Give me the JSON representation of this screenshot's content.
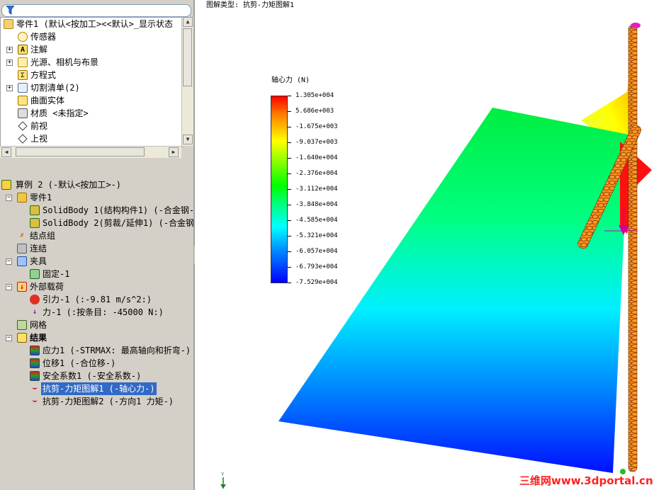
{
  "feature_tree": {
    "items": [
      {
        "label": "零件1  (默认<按加工><<默认>_显示状态",
        "icon": "part-icon"
      },
      {
        "label": "传感器",
        "icon": "sensor-icon"
      },
      {
        "label": "注解",
        "icon": "annotation-icon"
      },
      {
        "label": "光源、相机与布景",
        "icon": "lights-icon"
      },
      {
        "label": "方程式",
        "icon": "equations-icon"
      },
      {
        "label": "切割清单(2)",
        "icon": "cutlist-icon"
      },
      {
        "label": "曲面实体",
        "icon": "surface-body-icon"
      },
      {
        "label": "材质 <未指定>",
        "icon": "material-icon"
      },
      {
        "label": "前视",
        "icon": "plane-icon"
      },
      {
        "label": "上视",
        "icon": "plane-icon"
      }
    ]
  },
  "study_tree": {
    "items": [
      {
        "label": "算例 2 (-默认<按加工>-)"
      },
      {
        "label": "零件1"
      },
      {
        "label": "SolidBody 1(结构构件1) (-合金钢-"
      },
      {
        "label": "SolidBody 2(剪裁/延伸1) (-合金钢"
      },
      {
        "label": "结点组"
      },
      {
        "label": "连结"
      },
      {
        "label": "夹具"
      },
      {
        "label": "固定-1"
      },
      {
        "label": "外部载荷"
      },
      {
        "label": "引力-1 (:-9.81 m/s^2:)"
      },
      {
        "label": "力-1 (:按条目: -45000 N:)"
      },
      {
        "label": "网格"
      },
      {
        "label": "结果"
      },
      {
        "label": "应力1 (-STRMAX: 最高轴向和折弯-)"
      },
      {
        "label": "位移1 (-合位移-)"
      },
      {
        "label": "安全系数1 (-安全系数-)"
      },
      {
        "label": "抗剪-力矩图解1 (-轴心力-)"
      },
      {
        "label": "抗剪-力矩图解2 (-方向1 力矩-)"
      }
    ]
  },
  "graphics": {
    "plot_type": "图解类型:  抗剪-力矩图解1",
    "legend_title": "轴心力 (N)",
    "legend_values": [
      "1.305e+004",
      "5.686e+003",
      "-1.675e+003",
      "-9.037e+003",
      "-1.640e+004",
      "-2.376e+004",
      "-3.112e+004",
      "-3.848e+004",
      "-4.585e+004",
      "-5.321e+004",
      "-6.057e+004",
      "-6.793e+004",
      "-7.529e+004"
    ],
    "watermark": "三维网www.3dportal.cn",
    "axis_y_label": "Y"
  }
}
